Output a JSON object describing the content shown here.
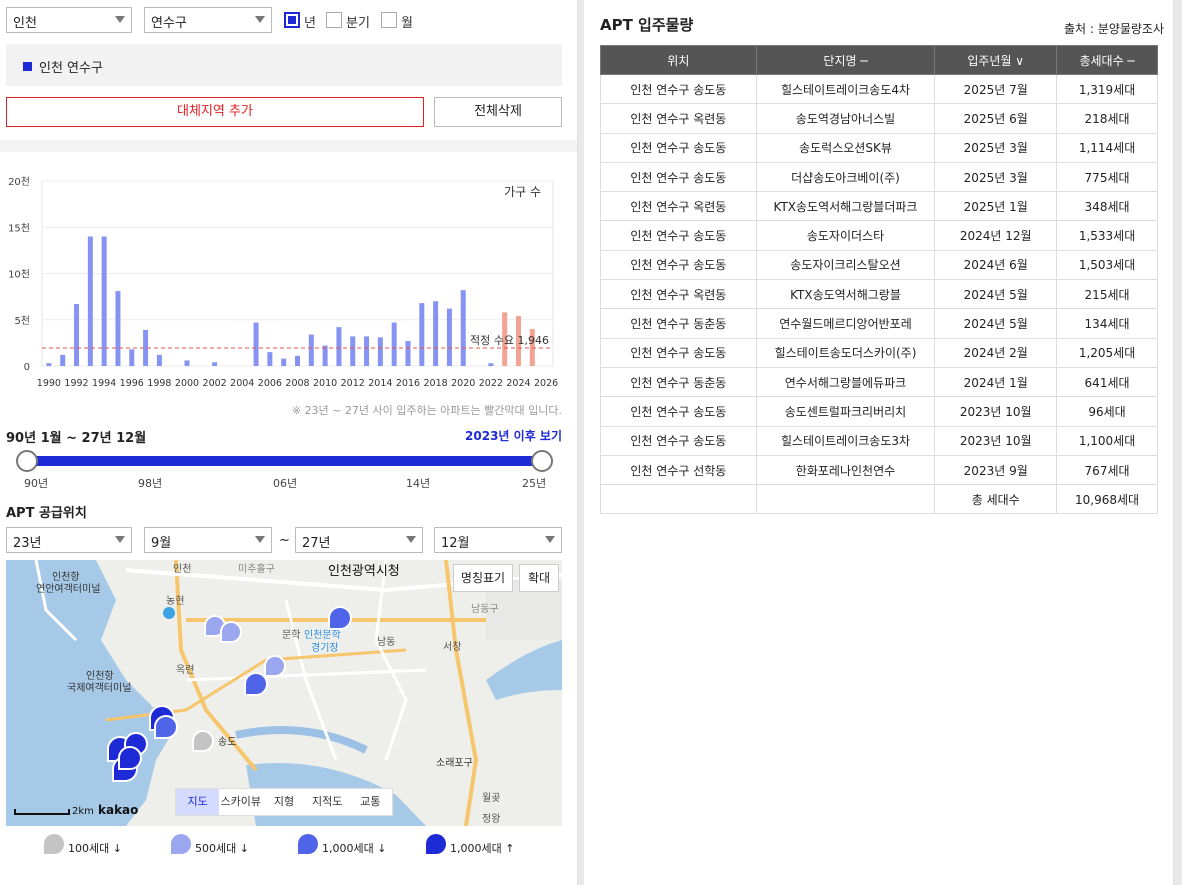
{
  "filters": {
    "city": "인천",
    "district": "연수구",
    "periods": [
      {
        "label": "년",
        "checked": true
      },
      {
        "label": "분기",
        "checked": false
      },
      {
        "label": "월",
        "checked": false
      }
    ]
  },
  "region": {
    "label": "인천 연수구"
  },
  "buttons": {
    "add_alt": "대체지역 추가",
    "delete_all": "전체삭제"
  },
  "chart_data": {
    "type": "bar",
    "series_label": "가구 수",
    "categories": [
      "1990",
      "1991",
      "1992",
      "1993",
      "1994",
      "1995",
      "1996",
      "1997",
      "1998",
      "1999",
      "2000",
      "2001",
      "2002",
      "2003",
      "2004",
      "2005",
      "2006",
      "2007",
      "2008",
      "2009",
      "2010",
      "2011",
      "2012",
      "2013",
      "2014",
      "2015",
      "2016",
      "2017",
      "2018",
      "2019",
      "2020",
      "2021",
      "2022",
      "2023",
      "2024",
      "2025",
      "2026"
    ],
    "values": [
      300,
      1200,
      6700,
      14000,
      14000,
      8100,
      1800,
      3900,
      1200,
      0,
      600,
      0,
      400,
      0,
      0,
      4700,
      1500,
      800,
      1100,
      3400,
      2200,
      4200,
      3200,
      3200,
      3100,
      4700,
      2700,
      6800,
      7000,
      6200,
      8200,
      0,
      300,
      5800,
      5400,
      4000,
      0
    ],
    "highlight_from": "2023",
    "colors": {
      "normal": "#8793f2",
      "highlight": "#f2a393",
      "line": "#e05555"
    },
    "x_tick_labels": [
      "1990",
      "1992",
      "1994",
      "1996",
      "1998",
      "2000",
      "2002",
      "2004",
      "2006",
      "2008",
      "2010",
      "2012",
      "2014",
      "2016",
      "2018",
      "2020",
      "2022",
      "2024",
      "2026"
    ],
    "y_ticks": [
      {
        "v": 0,
        "label": "0"
      },
      {
        "v": 5000,
        "label": "5천"
      },
      {
        "v": 10000,
        "label": "10천"
      },
      {
        "v": 15000,
        "label": "15천"
      },
      {
        "v": 20000,
        "label": "20천"
      }
    ],
    "ylim": [
      0,
      20000
    ],
    "reference": {
      "value": 1946,
      "label": "적정 수요 1,946"
    },
    "grid": true
  },
  "chart_note": "※ 23년 ~ 27년 사이 입주하는 아파트는 빨간막대 입니다.",
  "range": {
    "label": "90년 1월 ~ 27년 12월",
    "after_link": "2023년 이후 보기",
    "ticks": [
      "90년",
      "98년",
      "06년",
      "14년",
      "25년"
    ],
    "start_fraction": 0,
    "end_fraction": 1
  },
  "supply": {
    "title": "APT 공급위치",
    "from_year": "23년",
    "from_month": "9월",
    "tilde": "~",
    "to_year": "27년",
    "to_month": "12월"
  },
  "map": {
    "label_toggle": "명칭표기",
    "zoom": "확대",
    "tabs": [
      "지도",
      "스카이뷰",
      "지형",
      "지적도",
      "교통"
    ],
    "active_tab": "지도",
    "scale": "2km",
    "brand": "kakao",
    "labels": {
      "city_hall": "인천광역시청",
      "port1": "인천항",
      "port1b": "연안여객터미널",
      "port2": "인천항",
      "port2b": "국제여객터미널",
      "stadium": "인천문학",
      "stadium2": "경기장",
      "namdong": "남동",
      "songdo": "송도",
      "sorae": "소래포구",
      "namdonggu": "남동구",
      "munhak": "문학",
      "okryeon": "옥련",
      "seochang": "서창",
      "incheon": "인천",
      "nonghyeon": "농현",
      "wolgot": "월곶",
      "jeongwang": "정왕",
      "michuhol": "미추홀구"
    }
  },
  "legend": [
    {
      "label": "100세대 ↓",
      "color": "#c4c4c4"
    },
    {
      "label": "500세대 ↓",
      "color": "#9aa6ee"
    },
    {
      "label": "1,000세대 ↓",
      "color": "#4f64e8"
    },
    {
      "label": "1,000세대 ↑",
      "color": "#1d2ad6"
    }
  ],
  "panel": {
    "title": "APT 입주물량",
    "source": "출처 : 분양물량조사"
  },
  "table": {
    "headers": [
      "위치",
      "단지명 ─",
      "입주년월 ∨",
      "총세대수 ─"
    ],
    "rows": [
      [
        "인천 연수구 송도동",
        "힐스테이트레이크송도4차",
        "2025년 7월",
        "1,319세대"
      ],
      [
        "인천 연수구 옥련동",
        "송도역경남아너스빌",
        "2025년 6월",
        "218세대"
      ],
      [
        "인천 연수구 송도동",
        "송도럭스오션SK뷰",
        "2025년 3월",
        "1,114세대"
      ],
      [
        "인천 연수구 송도동",
        "더샵송도아크베이(주)",
        "2025년 3월",
        "775세대"
      ],
      [
        "인천 연수구 옥련동",
        "KTX송도역서해그랑블더파크",
        "2025년 1월",
        "348세대"
      ],
      [
        "인천 연수구 송도동",
        "송도자이더스타",
        "2024년 12월",
        "1,533세대"
      ],
      [
        "인천 연수구 송도동",
        "송도자이크리스탈오션",
        "2024년 6월",
        "1,503세대"
      ],
      [
        "인천 연수구 옥련동",
        "KTX송도역서해그랑블",
        "2024년 5월",
        "215세대"
      ],
      [
        "인천 연수구 동춘동",
        "연수월드메르디앙어반포레",
        "2024년 5월",
        "134세대"
      ],
      [
        "인천 연수구 송도동",
        "힐스테이트송도더스카이(주)",
        "2024년 2월",
        "1,205세대"
      ],
      [
        "인천 연수구 동춘동",
        "연수서해그랑블에듀파크",
        "2024년 1월",
        "641세대"
      ],
      [
        "인천 연수구 송도동",
        "송도센트럴파크리버리치",
        "2023년 10월",
        "96세대"
      ],
      [
        "인천 연수구 송도동",
        "힐스테이트레이크송도3차",
        "2023년 10월",
        "1,100세대"
      ],
      [
        "인천 연수구 선학동",
        "한화포레나인천연수",
        "2023년 9월",
        "767세대"
      ]
    ],
    "total_label": "총 세대수",
    "total_value": "10,968세대"
  }
}
